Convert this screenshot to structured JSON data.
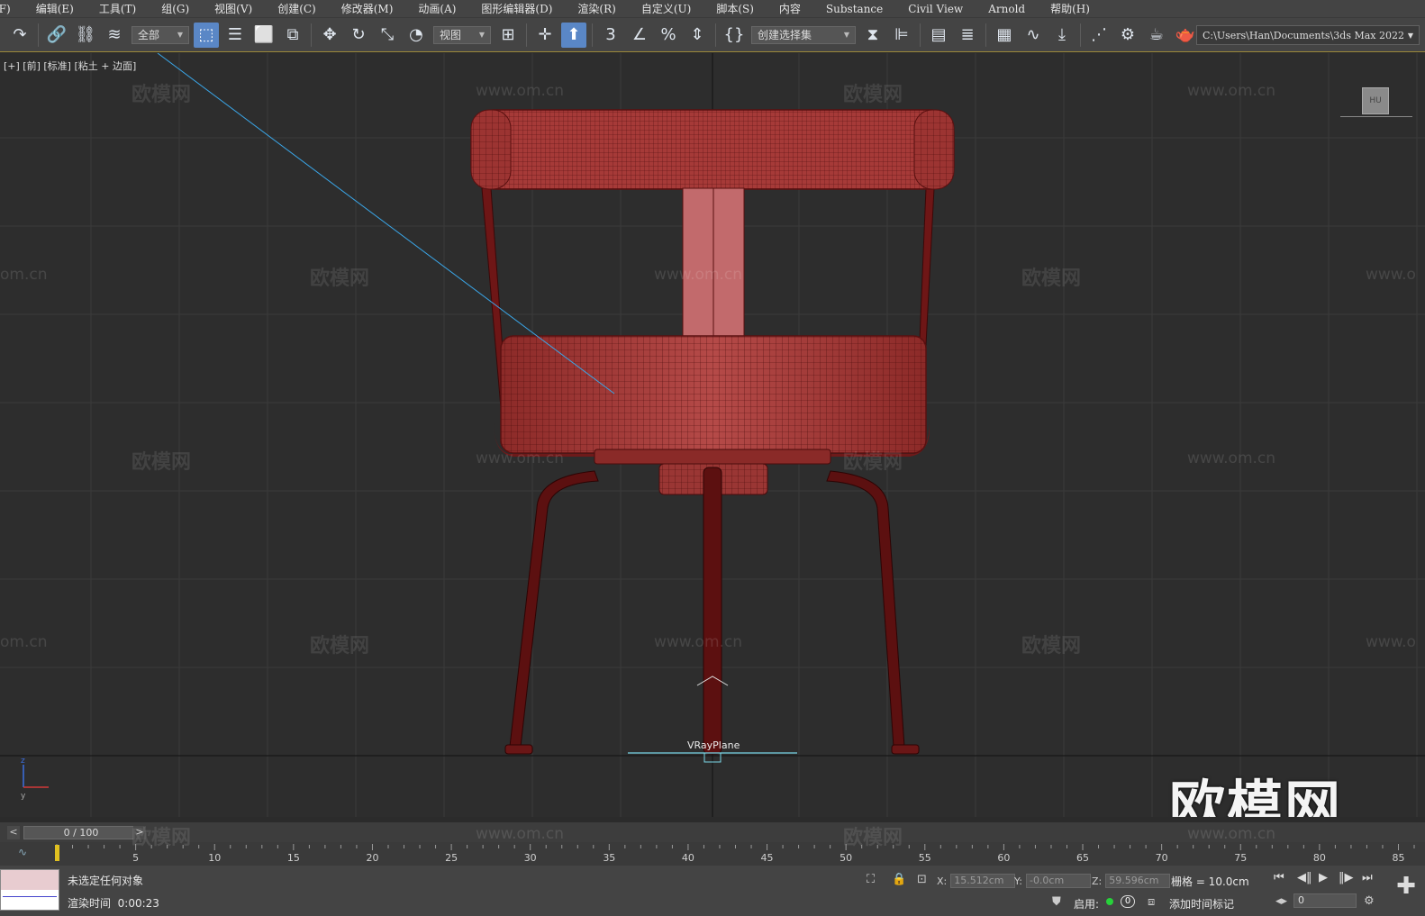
{
  "menu": [
    "(F)",
    "编辑(E)",
    "工具(T)",
    "组(G)",
    "视图(V)",
    "创建(C)",
    "修改器(M)",
    "动画(A)",
    "图形编辑器(D)",
    "渲染(R)",
    "自定义(U)",
    "脚本(S)",
    "内容",
    "Substance",
    "Civil View",
    "Arnold",
    "帮助(H)"
  ],
  "toolbar": {
    "filter_label": "全部",
    "ref_coord_label": "视图",
    "selection_set_label": "创建选择集",
    "path": "C:\\Users\\Han\\Documents\\3ds Max 2022"
  },
  "viewport": {
    "label": "[+] [前] [标准] [粘土 + 边面]",
    "object_label": "VRayPlane",
    "viewcube_label": "HU",
    "watermark_text": "欧模网",
    "watermark_url": "www.om.cn",
    "watermark_url_partial": "om.cn",
    "watermark_url_right": "www.o",
    "big_watermark": "欧模网"
  },
  "timeline": {
    "frame_display": "0 / 100",
    "prev": "<",
    "next": ">",
    "ticks": [
      "5",
      "10",
      "15",
      "20",
      "25",
      "30",
      "35",
      "40",
      "45",
      "50",
      "55",
      "60",
      "65",
      "70",
      "75",
      "80",
      "85"
    ]
  },
  "status": {
    "selection": "未选定任何对象",
    "render_time_label": "渲染时间",
    "render_time_value": "0:00:23",
    "x_label": "X:",
    "x_value": "15.512cm",
    "y_label": "Y:",
    "y_value": "-0.0cm",
    "z_label": "Z:",
    "z_value": "59.596cm",
    "grid": "栅格 = 10.0cm",
    "enable_label": "启用:",
    "enable_count": "0",
    "add_time_tag": "添加时间标记",
    "frame_input": "0"
  },
  "colors": {
    "chair_fill": "#a83a38",
    "chair_dark": "#5c1010",
    "grid_line": "#3c3c3c",
    "accent": "#5a87c6"
  }
}
